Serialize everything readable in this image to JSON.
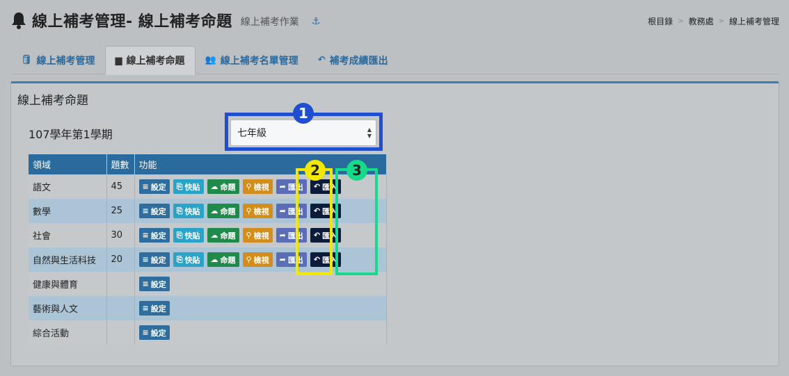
{
  "header": {
    "title": "線上補考管理- 線上補考命題",
    "subtitle": "線上補考作業"
  },
  "breadcrumb": [
    "根目錄",
    "教務處",
    "線上補考管理"
  ],
  "tabs": [
    {
      "label": "線上補考管理",
      "icon": "database-icon"
    },
    {
      "label": "線上補考命題",
      "icon": "archive-icon",
      "active": true
    },
    {
      "label": "線上補考名單管理",
      "icon": "users-icon"
    },
    {
      "label": "補考成績匯出",
      "icon": "reply-icon"
    }
  ],
  "panel": {
    "title": "線上補考命題",
    "semester": "107學年第1學期",
    "grade_select": {
      "value": "七年級"
    }
  },
  "annotations": [
    "1",
    "2",
    "3"
  ],
  "table": {
    "headers": [
      "領域",
      "題數",
      "功能"
    ],
    "buttons": {
      "set": "設定",
      "paste": "快貼",
      "cmd": "命題",
      "view": "檢視",
      "export": "匯出",
      "import": "匯入"
    },
    "rows": [
      {
        "domain": "語文",
        "count": "45",
        "full": true
      },
      {
        "domain": "數學",
        "count": "25",
        "full": true
      },
      {
        "domain": "社會",
        "count": "30",
        "full": true
      },
      {
        "domain": "自然與生活科技",
        "count": "20",
        "full": true
      },
      {
        "domain": "健康與體育",
        "count": "",
        "full": false
      },
      {
        "domain": "藝術與人文",
        "count": "",
        "full": false
      },
      {
        "domain": "綜合活動",
        "count": "",
        "full": false
      }
    ]
  },
  "colors": {
    "accent": "#2a6a9c",
    "annotation_blue": "#1f4fd0",
    "annotation_yellow": "#f2e800",
    "annotation_green": "#17d98c"
  }
}
